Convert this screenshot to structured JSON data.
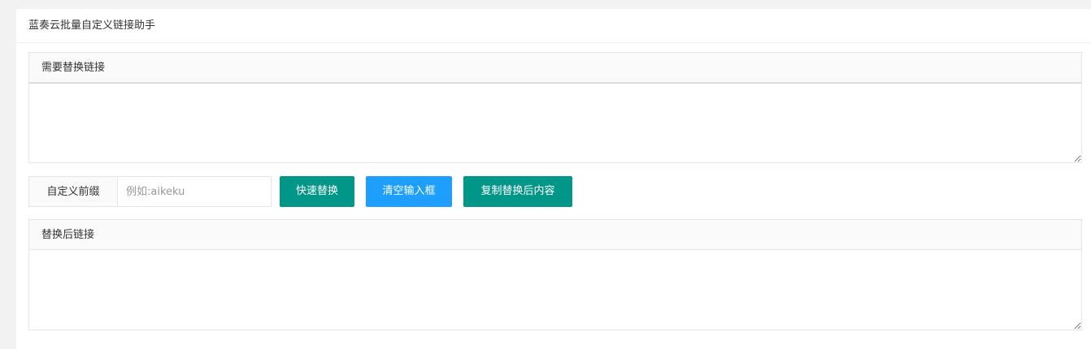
{
  "app": {
    "title": "蓝奏云批量自定义链接助手"
  },
  "input_panel": {
    "title": "需要替换链接",
    "value": ""
  },
  "controls": {
    "prefix_label": "自定义前缀",
    "prefix_placeholder": "例如:aikeku",
    "prefix_value": "",
    "replace_label": "快速替换",
    "clear_label": "清空输入框",
    "copy_label": "复制替换后内容"
  },
  "output_panel": {
    "title": "替换后链接",
    "value": ""
  },
  "colors": {
    "primary_green": "#009688",
    "primary_blue": "#1E9FFF",
    "page_background": "#f2f2f2"
  }
}
